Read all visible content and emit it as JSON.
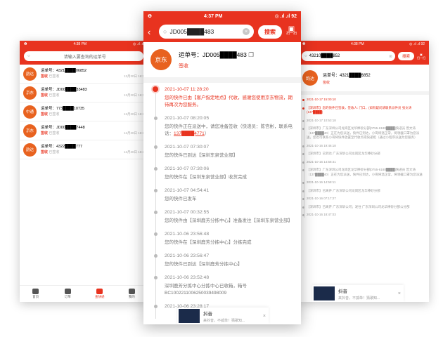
{
  "left": {
    "status": {
      "time": "4:38 PM",
      "right": "◎ .ıl .ıl"
    },
    "search_placeholder": "请输入要查询的运单号",
    "items": [
      {
        "courier": "韵达",
        "number": "运单号：4321████06852",
        "status": "签收",
        "note": "已签收",
        "time": "12月20日 16:3",
        "color": "#e8621f"
      },
      {
        "courier": "京东",
        "number": "运单号：JD00████33483",
        "status": "签收",
        "note": "已签收",
        "time": "12月20日 16:3",
        "color": "#e8621f"
      },
      {
        "courier": "中通",
        "number": "运单号：773████10735",
        "status": "签收",
        "note": "已签收",
        "time": "12月20日 16:3",
        "color": "#e8621f"
      },
      {
        "courier": "京东",
        "number": "运单号：JD00████7448",
        "status": "签收",
        "note": "已签收",
        "time": "12月20日 16:3",
        "color": "#e8621f"
      },
      {
        "courier": "韵达",
        "number": "运单号：4322████777",
        "status": "签收",
        "note": "已签收",
        "time": "12月20日 16:3",
        "color": "#e8621f"
      }
    ],
    "nav": [
      {
        "label": "首页",
        "icon": "home-icon",
        "active": false
      },
      {
        "label": "订单",
        "icon": "order-icon",
        "active": false
      },
      {
        "label": "查快递",
        "icon": "package-icon",
        "active": true
      },
      {
        "label": "我的",
        "icon": "user-icon",
        "active": false
      }
    ]
  },
  "center": {
    "status": {
      "time": "4:37 PM",
      "right": "◎ .ıl .ıl 92",
      "left": "❶"
    },
    "search_value": "JD005████483",
    "search_button": "搜索",
    "scan_label": "扫一扫",
    "courier_logo": "京东",
    "waybill": "运单号：JD005████483",
    "waybill_status": "签收",
    "events": [
      {
        "time": "2021-10-07 11:28:20",
        "desc": "您的快件已由【客户指定地点】代收，感谢您使用京东物流，期待再次为您服务。"
      },
      {
        "time": "2021-10-07 08:20:05",
        "desc": "您的快件正在派送中，请您准备签收（快递员：陈宫彬，联系电话：",
        "phone": "137████4771",
        "desc_tail": "）"
      },
      {
        "time": "2021-10-07 07:30:07",
        "desc": "您的快件已到达【深圳东泉营业部】"
      },
      {
        "time": "2021-10-07 07:30:06",
        "desc": "您的快件在【深圳东泉营业部】收货完成"
      },
      {
        "time": "2021-10-07 04:54:41",
        "desc": "您的快件已发车"
      },
      {
        "time": "2021-10-07 00:32:55",
        "desc": "您的快件由【深圳鹿芳分拣中心】准备发往【深圳东泉营业部】"
      },
      {
        "time": "2021-10-06 23:56:48",
        "desc": "您的快件在【深圳鹿芳分拣中心】分拣完成"
      },
      {
        "time": "2021-10-06 23:56:47",
        "desc": "您的快件已到达【深圳鹿芳分拣中心】"
      },
      {
        "time": "2021-10-06 23:52:48",
        "desc": "深圳鹿芳分拣中心分拣中心已收箱，箱号BC1002211006250039498009"
      },
      {
        "time": "2021-10-06 23:28:17",
        "desc": ""
      }
    ],
    "ad": {
      "title": "抖音",
      "sub": "来抖音，不孤单！猜歌知...",
      "close": "×"
    }
  },
  "right": {
    "status": {
      "time": "4:38 PM",
      "right": "◎ .ıl .ıl 92"
    },
    "search_value": "43210████852",
    "search_button": "搜索",
    "scan_label": "扫一扫",
    "courier_logo": "韵达",
    "waybill": "运单号：4321████6852",
    "waybill_status": "签收",
    "events": [
      "2021-10-17 15:00:10",
      "【深圳市】您的快件已签收，签收人: 门口，(如有疑问请联系派件员 张文涛(137████)",
      "2021-10-17 10:53:18",
      "【深圳市】广东深圳公司龙岗区龙华棒砂分部[0755-6180████]快递员 曾文涛（137████40）正在为您派送，快件已到达，小哥将温正常，将领截口罩为您派送，您也可联系小哥将快件放置至代收点或快递柜（通过小程序派送为您服务）",
      "2021-10-16 19:46:18",
      "【深圳市】已到达 广东深圳公司龙岗区龙华棒砂分部",
      "2021-10-16 14:58:41",
      "【深圳市】广东深圳公司龙岗区龙华棒砂分部[0755-6180████]快递员 曾文涛（137████40）正在为您派送，快件已到达，小哥将温正常，将领截口罩为您派送",
      "2021-10-16 14:58:11",
      "【深圳市】已离开 广东深圳公司龙岗区龙华棒砂分部",
      "2021-10-16 07:17:27",
      "【深圳市】已离开 广东深圳公司；发往 广东深圳公司龙华棒砂分部公分部",
      "2021-10-16 18:47:03"
    ],
    "ad": {
      "title": "抖音",
      "sub": "来抖音，不孤单！猜歌知..."
    }
  }
}
